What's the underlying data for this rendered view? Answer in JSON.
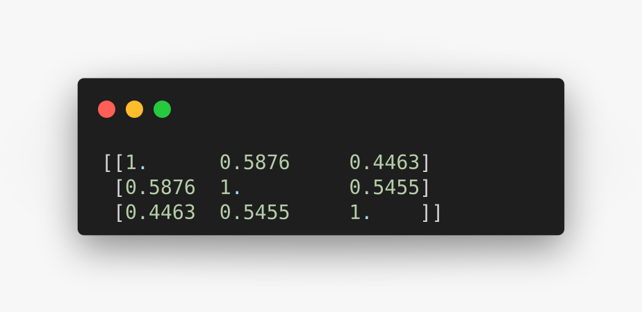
{
  "window": {
    "traffic_lights": [
      {
        "name": "close",
        "color": "#ff5f56"
      },
      {
        "name": "minimize",
        "color": "#ffbd2e"
      },
      {
        "name": "zoom",
        "color": "#27c93f"
      }
    ]
  },
  "colors": {
    "background": "#1e1e1e",
    "number": "#b5cea8",
    "bracket": "#d4d4d4",
    "decimal_point": "#9cdcfe"
  },
  "output": {
    "lines": [
      [
        {
          "t": "bracket",
          "v": "[["
        },
        {
          "t": "num",
          "v": "1"
        },
        {
          "t": "dotc",
          "v": "."
        },
        {
          "t": "space",
          "v": "      "
        },
        {
          "t": "num",
          "v": "0.5876"
        },
        {
          "t": "space",
          "v": "     "
        },
        {
          "t": "num",
          "v": "0.4463"
        },
        {
          "t": "bracket",
          "v": "]"
        }
      ],
      [
        {
          "t": "space",
          "v": " "
        },
        {
          "t": "bracket",
          "v": "["
        },
        {
          "t": "num",
          "v": "0.5876"
        },
        {
          "t": "space",
          "v": "  "
        },
        {
          "t": "num",
          "v": "1"
        },
        {
          "t": "dotc",
          "v": "."
        },
        {
          "t": "space",
          "v": "         "
        },
        {
          "t": "num",
          "v": "0.5455"
        },
        {
          "t": "bracket",
          "v": "]"
        }
      ],
      [
        {
          "t": "space",
          "v": " "
        },
        {
          "t": "bracket",
          "v": "["
        },
        {
          "t": "num",
          "v": "0.4463"
        },
        {
          "t": "space",
          "v": "  "
        },
        {
          "t": "num",
          "v": "0.5455"
        },
        {
          "t": "space",
          "v": "     "
        },
        {
          "t": "num",
          "v": "1"
        },
        {
          "t": "dotc",
          "v": "."
        },
        {
          "t": "space",
          "v": "    "
        },
        {
          "t": "bracket",
          "v": "]]"
        }
      ]
    ]
  }
}
